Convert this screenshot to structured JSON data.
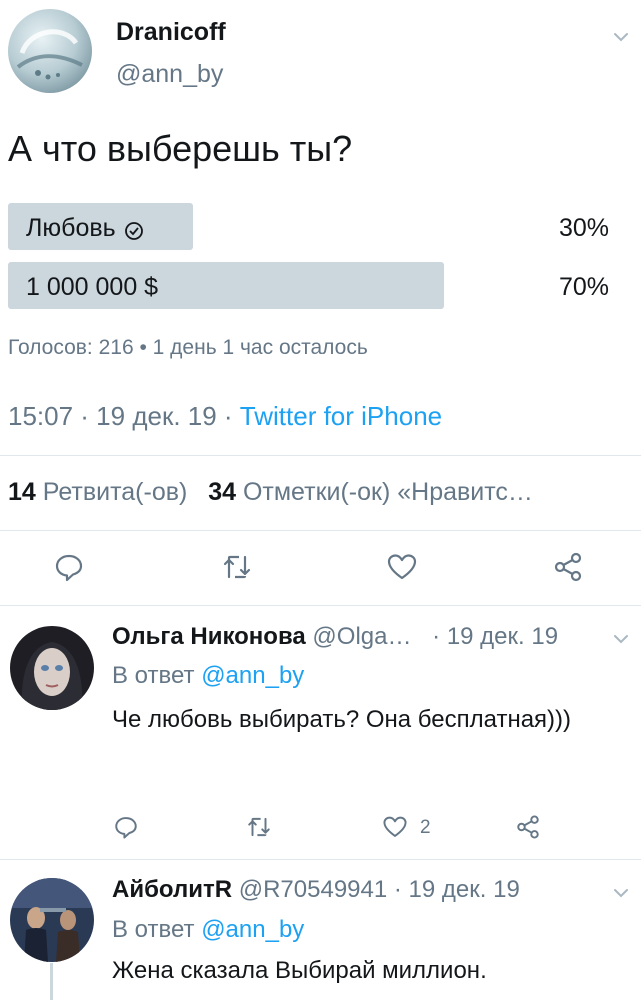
{
  "tweet": {
    "author_name": "Dranicoff",
    "author_handle": "@ann_by",
    "text": "А что выберешь ты?",
    "poll": {
      "options": [
        {
          "label": "Любовь",
          "percent_text": "30%",
          "percent": 30,
          "selected": true
        },
        {
          "label": "1 000 000 $",
          "percent_text": "70%",
          "percent": 70,
          "selected": false
        }
      ],
      "meta": "Голосов: 216 • 1 день 1 час осталось"
    },
    "time": "15:07 · 19 дек. 19 · ",
    "source": "Twitter for iPhone",
    "retweets_count": "14",
    "retweets_label": "Ретвита(-ов)",
    "likes_count": "34",
    "likes_label": "Отметки(-ок) «Нравитс…"
  },
  "replies": [
    {
      "name": "Ольга Никонова",
      "handle": "@Olga…",
      "date": "· 19 дек. 19",
      "reply_prefix": "В ответ ",
      "reply_to": "@ann_by",
      "text": "Че любовь выбирать? Она бесплатная)))",
      "like_count": "2"
    },
    {
      "name": "АйболитR",
      "handle": "@R70549941",
      "date": "· 19 дек. 19",
      "reply_prefix": "В ответ ",
      "reply_to": "@ann_by",
      "text": "Жена сказала Выбирай миллион."
    }
  ],
  "icons": {
    "reply": "reply-icon",
    "retweet": "retweet-icon",
    "like": "heart-icon",
    "share": "share-icon",
    "more": "chevron-down-icon",
    "voted": "check-circle-icon"
  },
  "colors": {
    "accent": "#1da1f2",
    "secondary_text": "#657786",
    "poll_bar": "#ccd6dd",
    "divider": "#e1e8ed"
  }
}
